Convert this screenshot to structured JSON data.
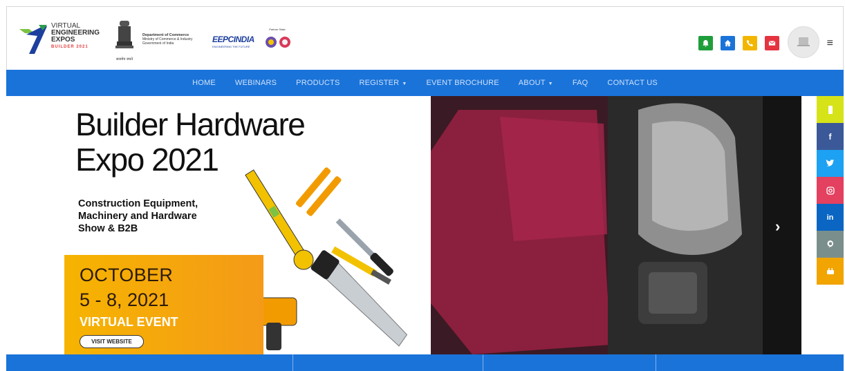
{
  "header": {
    "logo": {
      "line1": "VIRTUAL",
      "line2": "ENGINEERING",
      "line3": "EXPOS",
      "tag": "BUILDER 2021"
    },
    "emblem_caption": "सत्यमेव जयते",
    "dept": {
      "line1": "Department of Commerce",
      "line2": "Ministry of Commerce & Industry",
      "line3": "Government of India"
    },
    "eepc": "EEPCINDIA",
    "eepc_sub": "ENGINEERING THE FUTURE",
    "partner_label": "Partner State",
    "icons": [
      {
        "name": "bell-icon",
        "color": "#1e9e3a"
      },
      {
        "name": "home-icon",
        "color": "#1a73d9"
      },
      {
        "name": "phone-icon",
        "color": "#f2b600"
      },
      {
        "name": "mail-icon",
        "color": "#e53340"
      }
    ]
  },
  "nav": {
    "items": [
      {
        "label": "HOME",
        "dropdown": false
      },
      {
        "label": "WEBINARS",
        "dropdown": false
      },
      {
        "label": "PRODUCTS",
        "dropdown": false
      },
      {
        "label": "REGISTER",
        "dropdown": true
      },
      {
        "label": "EVENT BROCHURE",
        "dropdown": false
      },
      {
        "label": "ABOUT",
        "dropdown": true
      },
      {
        "label": "FAQ",
        "dropdown": false
      },
      {
        "label": "CONTACT US",
        "dropdown": false
      }
    ]
  },
  "hero": {
    "title_line1": "Builder Hardware",
    "title_line2": "Expo 2021",
    "subtitle_line1": "Construction Equipment,",
    "subtitle_line2": "Machinery and Hardware",
    "subtitle_line3": "Show & B2B",
    "date_month": "OCTOBER",
    "date_days": "5 - 8, 2021",
    "event_type": "VIRTUAL EVENT",
    "cta": "VISIT WEBSITE",
    "accent": "#f6b400"
  },
  "social": [
    {
      "name": "notification-icon",
      "color": "#d6e319"
    },
    {
      "name": "facebook-icon",
      "color": "#3b5998",
      "glyph": "f"
    },
    {
      "name": "twitter-icon",
      "color": "#1da1f2",
      "glyph": "t"
    },
    {
      "name": "instagram-icon",
      "color": "#e4405f",
      "glyph": "◎"
    },
    {
      "name": "linkedin-icon",
      "color": "#0a66c2",
      "glyph": "in"
    },
    {
      "name": "pinterest-icon",
      "color": "#7a8f8c",
      "glyph": "P"
    },
    {
      "name": "youtube-icon",
      "color": "#f2a400",
      "glyph": "▶"
    }
  ]
}
